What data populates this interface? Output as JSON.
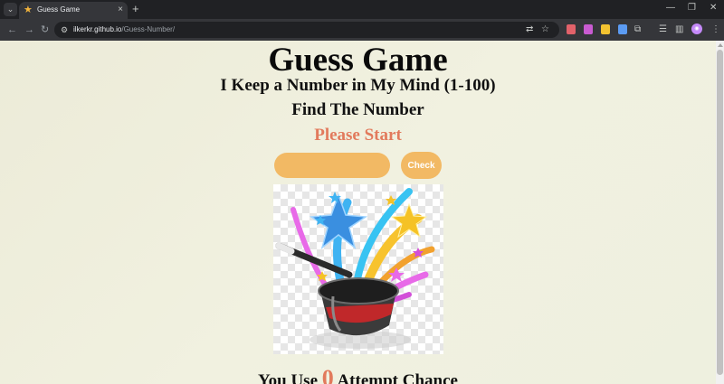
{
  "browser": {
    "tab": {
      "title": "Guess Game",
      "favicon": "star-icon"
    },
    "url": {
      "host": "ilkerkr.github.io",
      "path": "/Guess-Number/"
    }
  },
  "page": {
    "title": "Guess Game",
    "subtitle": "I Keep a Number in My Mind (1-100)",
    "instruction": "Find The Number",
    "status": "Please Start",
    "input": {
      "value": "",
      "placeholder": ""
    },
    "check_label": "Check",
    "image_alt": "magic-hat-icon",
    "attempts": {
      "prefix": "You Use",
      "count": "0",
      "suffix": "Attempt Chance"
    }
  },
  "colors": {
    "accent": "#f2b964",
    "status": "#e27a5c",
    "background": "#eeeedc"
  }
}
